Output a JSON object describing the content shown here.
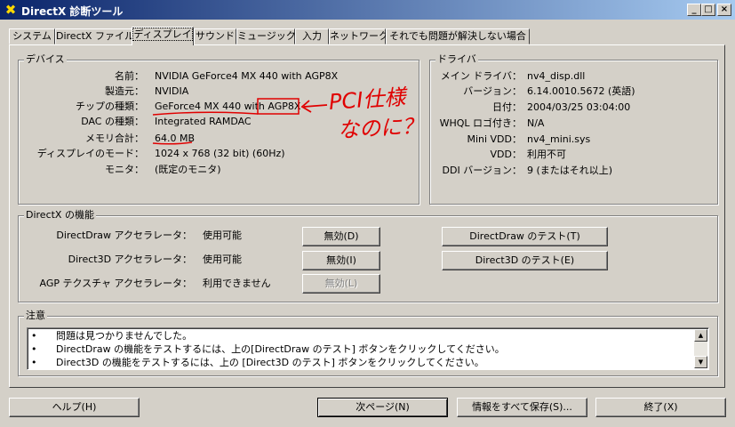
{
  "window": {
    "title": "DirectX 診断ツール",
    "app_icon": "directx-x-icon",
    "controls": [
      "_",
      "□",
      "×"
    ]
  },
  "tabs": [
    "システム",
    "DirectX ファイル",
    "ディスプレイ",
    "サウンド",
    "ミュージック",
    "入力",
    "ネットワーク",
    "それでも問題が解決しない場合"
  ],
  "active_tab": "ディスプレイ",
  "device": {
    "title": "デバイス",
    "rows": [
      {
        "label": "名前：",
        "value": "NVIDIA GeForce4 MX 440 with AGP8X"
      },
      {
        "label": "製造元：",
        "value": "NVIDIA"
      },
      {
        "label": "チップの種類：",
        "value": "GeForce4 MX 440 with AGP8X"
      },
      {
        "label": "DAC の種類：",
        "value": "Integrated RAMDAC"
      },
      {
        "label": "メモリ合計：",
        "value": "64.0 MB"
      },
      {
        "label": "ディスプレイのモード：",
        "value": "1024 x 768 (32 bit) (60Hz)"
      },
      {
        "label": "モニタ：",
        "value": "(既定のモニタ)"
      }
    ]
  },
  "driver": {
    "title": "ドライバ",
    "rows": [
      {
        "label": "メイン ドライバ：",
        "value": "nv4_disp.dll"
      },
      {
        "label": "バージョン：",
        "value": "6.14.0010.5672 (英語)"
      },
      {
        "label": "日付：",
        "value": "2004/03/25 03:04:00"
      },
      {
        "label": "WHQL ロゴ付き：",
        "value": "N/A"
      },
      {
        "label": "Mini VDD：",
        "value": "nv4_mini.sys"
      },
      {
        "label": "VDD：",
        "value": "利用不可"
      },
      {
        "label": "DDI バージョン：",
        "value": "9 (またはそれ以上)"
      }
    ]
  },
  "features": {
    "title": "DirectX の機能",
    "rows": [
      {
        "label": "DirectDraw アクセラレータ：",
        "status": "使用可能",
        "toggle": "無効(D)",
        "test": "DirectDraw のテスト(T)"
      },
      {
        "label": "Direct3D アクセラレータ：",
        "status": "使用可能",
        "toggle": "無効(I)",
        "test": "Direct3D のテスト(E)"
      },
      {
        "label": "AGP テクスチャ アクセラレータ：",
        "status": "利用できません",
        "toggle": "無効(L)"
      }
    ]
  },
  "notes": {
    "title": "注意",
    "bullet": "•",
    "items": [
      "問題は見つかりませんでした。",
      "DirectDraw の機能をテストするには、上の[DirectDraw のテスト] ボタンをクリックしてください。",
      "Direct3D の機能をテストするには、上の [Direct3D のテスト] ボタンをクリックしてください。"
    ],
    "scroll_up": "▲",
    "scroll_down": "▼"
  },
  "annotation": {
    "text_line1": "PCI仕様",
    "text_line2": "なのに？",
    "color": "#e00000",
    "arrow": "←"
  },
  "footer": {
    "help": "ヘルプ(H)",
    "next": "次ページ(N)",
    "save_all": "情報をすべて保存(S)...",
    "exit": "終了(X)"
  }
}
